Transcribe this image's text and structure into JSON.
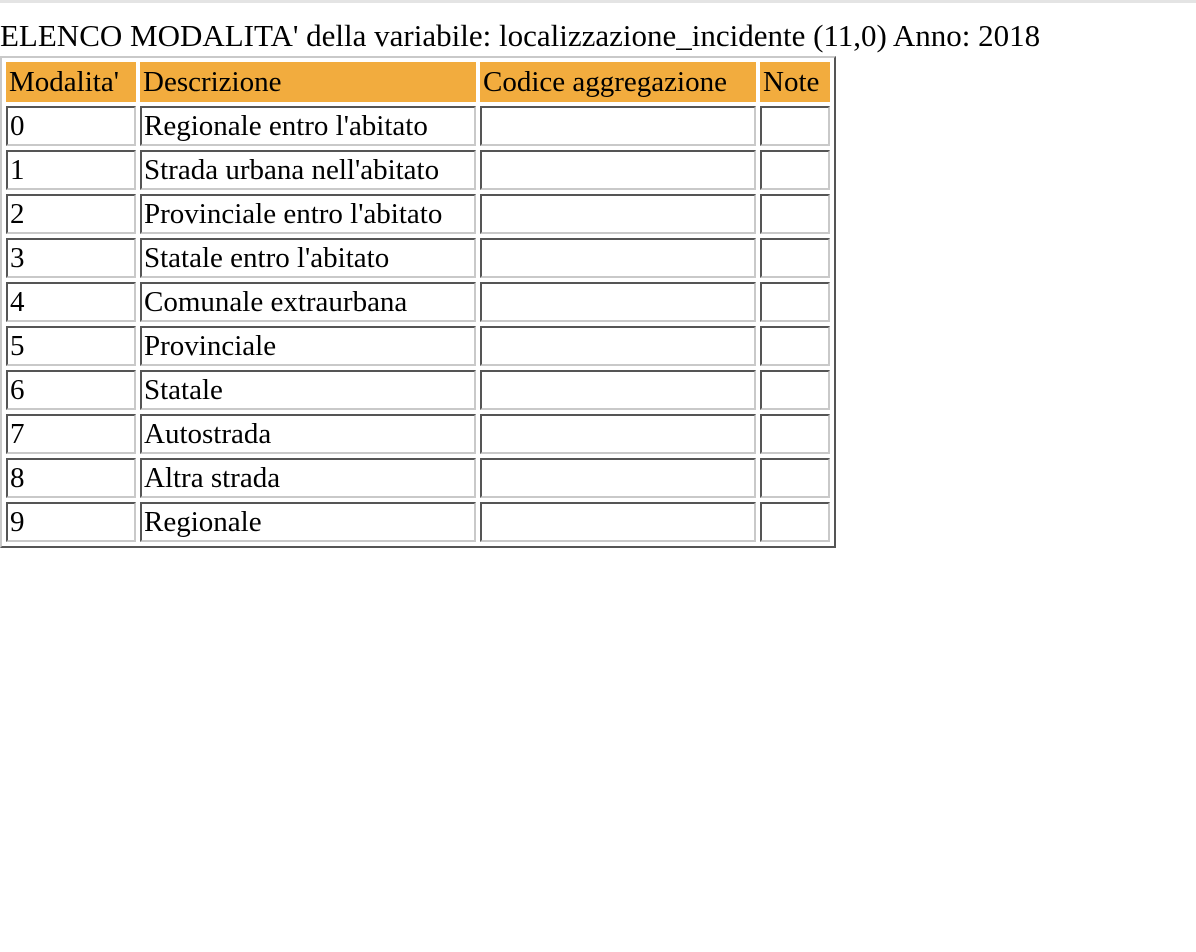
{
  "page": {
    "title": "ELENCO MODALITA' della variabile: localizzazione_incidente (11,0) Anno: 2018"
  },
  "table": {
    "header_color": "#f2ac3e",
    "columns": [
      "Modalita'",
      "Descrizione",
      "Codice aggregazione",
      "Note"
    ],
    "rows": [
      {
        "modalita": "0",
        "descrizione": "Regionale entro l'abitato",
        "codice": "",
        "note": ""
      },
      {
        "modalita": "1",
        "descrizione": "Strada urbana nell'abitato",
        "codice": "",
        "note": ""
      },
      {
        "modalita": "2",
        "descrizione": "Provinciale entro l'abitato",
        "codice": "",
        "note": ""
      },
      {
        "modalita": "3",
        "descrizione": "Statale entro l'abitato",
        "codice": "",
        "note": ""
      },
      {
        "modalita": "4",
        "descrizione": "Comunale extraurbana",
        "codice": "",
        "note": ""
      },
      {
        "modalita": "5",
        "descrizione": "Provinciale",
        "codice": "",
        "note": ""
      },
      {
        "modalita": "6",
        "descrizione": "Statale",
        "codice": "",
        "note": ""
      },
      {
        "modalita": "7",
        "descrizione": "Autostrada",
        "codice": "",
        "note": ""
      },
      {
        "modalita": "8",
        "descrizione": "Altra strada",
        "codice": "",
        "note": ""
      },
      {
        "modalita": "9",
        "descrizione": "Regionale",
        "codice": "",
        "note": ""
      }
    ]
  }
}
